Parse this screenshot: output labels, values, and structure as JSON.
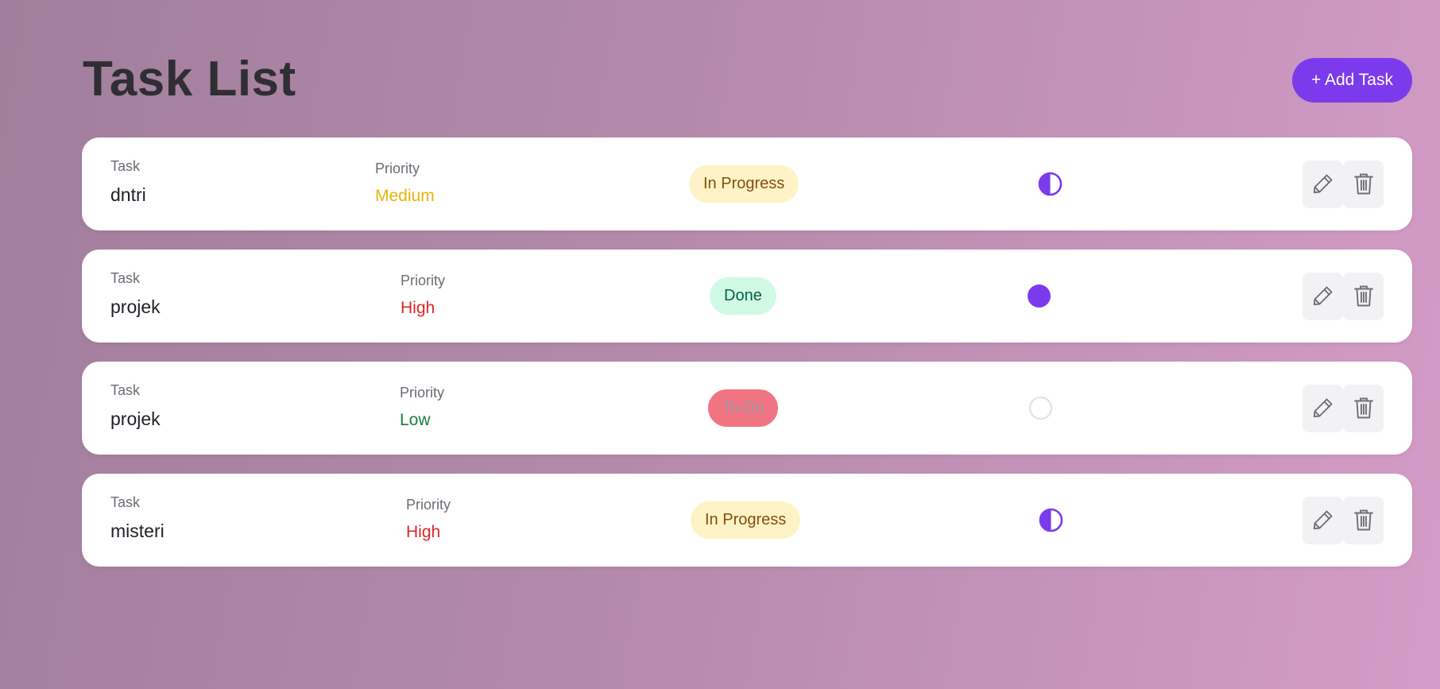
{
  "header": {
    "title": "Task List",
    "add_button_label": "+ Add Task"
  },
  "colors": {
    "accent": "#7c3aed",
    "priority_medium": "#eab308",
    "priority_high": "#dc2626",
    "priority_low": "#15803d",
    "status_in_progress_bg": "#fef3c7",
    "status_in_progress_text": "#854d0e",
    "status_done_bg": "#d1fae5",
    "status_done_text": "#065f46",
    "status_todo_bg": "#f07482",
    "status_todo_text": "#9a9aa0"
  },
  "labels": {
    "task": "Task",
    "priority": "Priority"
  },
  "tasks": [
    {
      "name": "dntri",
      "priority": "Medium",
      "priority_level": "medium",
      "status": "In Progress",
      "status_key": "in_progress",
      "progress": 0.5,
      "progress_icon": "half-circle-icon"
    },
    {
      "name": "projek",
      "priority": "High",
      "priority_level": "high",
      "status": "Done",
      "status_key": "done",
      "progress": 1.0,
      "progress_icon": "filled-circle-icon"
    },
    {
      "name": "projek",
      "priority": "Low",
      "priority_level": "low",
      "status": "To Do",
      "status_key": "todo",
      "progress": 0.0,
      "progress_icon": "empty-circle-icon"
    },
    {
      "name": "misteri",
      "priority": "High",
      "priority_level": "high",
      "status": "In Progress",
      "status_key": "in_progress",
      "progress": 0.5,
      "progress_icon": "half-circle-icon"
    }
  ],
  "actions": {
    "edit_icon": "pencil-icon",
    "delete_icon": "trash-icon"
  }
}
